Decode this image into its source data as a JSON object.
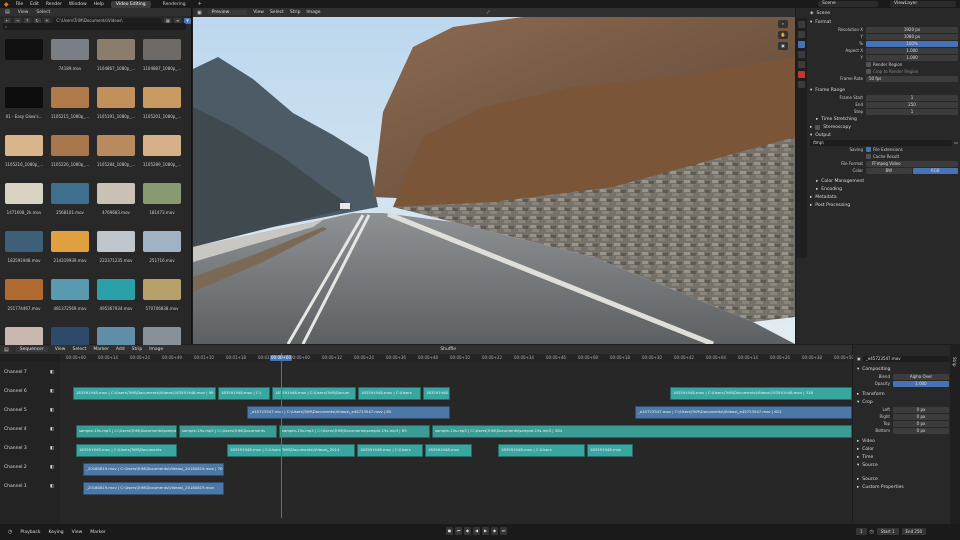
{
  "topbar": {
    "menus": [
      "File",
      "Edit",
      "Render",
      "Window",
      "Help"
    ],
    "workspaces": [
      {
        "label": "Video Editing",
        "active": true
      },
      {
        "label": "Rendering",
        "active": false
      }
    ],
    "scene": "Scene",
    "view_layer": "ViewLayer"
  },
  "file_browser": {
    "menus": [
      "View",
      "Select"
    ],
    "path": "C:\\Users\\TriM\\Documents\\Videos\\",
    "files": [
      {
        "name": "",
        "color": "#111111"
      },
      {
        "name": "74189.mov",
        "color": "#7a7f86"
      },
      {
        "name": "1104867_1080p_...",
        "color": "#8a7d6b"
      },
      {
        "name": "1104887_1080p_...",
        "color": "#6e6a66"
      },
      {
        "name": "01 - Easy Glow's...",
        "color": "#0d0d0d"
      },
      {
        "name": "1105215_1080p_...",
        "color": "#b07a4a"
      },
      {
        "name": "1105191_1080p_...",
        "color": "#c2905a"
      },
      {
        "name": "1105201_1080p_...",
        "color": "#c99b62"
      },
      {
        "name": "1105216_1080p_...",
        "color": "#d8b68a"
      },
      {
        "name": "1105226_1080p_...",
        "color": "#a8784c"
      },
      {
        "name": "1105284_1080p_...",
        "color": "#b88a5e"
      },
      {
        "name": "1105289_1080p_...",
        "color": "#d6b088"
      },
      {
        "name": "1471608_2k.mov",
        "color": "#d8d2c2"
      },
      {
        "name": "2568101.mov",
        "color": "#3f6f8f"
      },
      {
        "name": "4769683.mov",
        "color": "#c9c2b4"
      },
      {
        "name": "181473.mov",
        "color": "#8a9a70"
      },
      {
        "name": "183591948.mov",
        "color": "#3e5f78"
      },
      {
        "name": "214319939.mov",
        "color": "#e0a040"
      },
      {
        "name": "222371235.mov",
        "color": "#bfc6cc"
      },
      {
        "name": "251716.mov",
        "color": "#a0b2c4"
      },
      {
        "name": "251774467.mov",
        "color": "#b06a30"
      },
      {
        "name": "481372569.mov",
        "color": "#5a9ab0"
      },
      {
        "name": "495367934.mov",
        "color": "#2aa0a8"
      },
      {
        "name": "570706838.mov",
        "color": "#b8a06a"
      },
      {
        "name": "_23025734.mov",
        "color": "#c8b8b0"
      },
      {
        "name": "_20180819.mov",
        "color": "#2e4a6a"
      },
      {
        "name": "_19028844.mov",
        "color": "#5f8fa8"
      },
      {
        "name": "_67961324.mov",
        "color": "#88909a"
      }
    ],
    "selected_index": 25
  },
  "preview": {
    "menus": [
      "View",
      "Select",
      "Strip",
      "Image"
    ],
    "mode": "Preview"
  },
  "properties": {
    "header": "Scene",
    "format": {
      "title": "Format",
      "resolution_x": "1920 px",
      "resolution_y": "1080 px",
      "percent": "100%",
      "aspect_x": "1.000",
      "aspect_y": "1.000",
      "render_region": "Render Region",
      "crop_region": "Crop to Render Region",
      "frame_rate_label": "Frame Rate",
      "frame_rate": "50 fps"
    },
    "frame_range": {
      "title": "Frame Range",
      "start_label": "Frame Start",
      "start": "1",
      "end_label": "End",
      "end": "250",
      "step_label": "Step",
      "step": "1"
    },
    "time_stretching": "Time Stretching",
    "stereoscopy": "Stereoscopy",
    "output": {
      "title": "Output",
      "path": "/tmp\\",
      "saving_label": "Saving",
      "file_extensions": "File Extensions",
      "cache_result": "Cache Result",
      "file_format_label": "File Format",
      "file_format": "FFmpeg Video",
      "color_label": "Color",
      "color_bw": "BW",
      "color_rgb": "RGB"
    },
    "color_management": "Color Management",
    "encoding": "Encoding",
    "metadata": "Metadata",
    "post_processing": "Post Processing"
  },
  "sequencer": {
    "mode": "Sequencer",
    "menus": [
      "View",
      "Select",
      "Marker",
      "Add",
      "Strip",
      "Image"
    ],
    "shuffle": "Shuffle",
    "current_time": "00:00+00",
    "ticks": [
      "00:00+00",
      "00:00+14",
      "00:00+24",
      "00:00+49",
      "00:01+10",
      "00:01+18",
      "00:01+24",
      "00:00+00",
      "00:00+12",
      "00:00+24",
      "00:00+36",
      "00:00+48",
      "00:00+10",
      "00:00+22",
      "00:00+34",
      "00:00+46",
      "00:00+08",
      "00:00+18",
      "00:00+30",
      "00:00+42",
      "00:00+04",
      "00:00+14",
      "00:00+26",
      "00:00+38",
      "00:00+50"
    ],
    "channels": [
      "Channel 7",
      "Channel 6",
      "Channel 5",
      "Channel 4",
      "Channel 3",
      "Channel 2",
      "Channel 1"
    ],
    "strips": [
      {
        "ch": 5,
        "start": 73,
        "end": 216,
        "type": "seltxt",
        "label": "183591948.mov | C:\\Users\\TriM\\Documents\\Videos\\183591948.mov | 98"
      },
      {
        "ch": 5,
        "start": 218,
        "end": 270,
        "type": "seltxt",
        "label": "183591948.mov | C:\\"
      },
      {
        "ch": 5,
        "start": 272,
        "end": 356,
        "type": "seltxt",
        "label": "183591948.mov | C:\\Users\\TriM\\Docum"
      },
      {
        "ch": 5,
        "start": 358,
        "end": 421,
        "type": "seltxt",
        "label": "183591948.mov | C:\\Users"
      },
      {
        "ch": 5,
        "start": 423,
        "end": 450,
        "type": "seltxt",
        "label": "183591948"
      },
      {
        "ch": 5,
        "start": 670,
        "end": 852,
        "type": "seltxt",
        "label": "183591948.mov | C:\\Users\\TriM\\Documents\\Videos\\183591948.mov | 318"
      },
      {
        "ch": 4,
        "start": 247,
        "end": 450,
        "type": "movie",
        "label": "_e45723547.mov | C:\\Users\\TriM\\Documents\\Videos\\_e45723547.mov | 85"
      },
      {
        "ch": 4,
        "start": 635,
        "end": 852,
        "type": "movie",
        "label": "_e45723547.mov | C:\\Users\\TriM\\Documents\\Videos\\_e45723547.mov | 612"
      },
      {
        "ch": 3,
        "start": 76,
        "end": 177,
        "type": "sound",
        "label": "sample-15s.mp3 | C:\\Users\\TriM\\Documents\\sample-15s.mp3 | 4"
      },
      {
        "ch": 3,
        "start": 179,
        "end": 277,
        "type": "sound",
        "label": "sample-15s.mp3 | C:\\Users\\TriM\\Documents"
      },
      {
        "ch": 3,
        "start": 279,
        "end": 430,
        "type": "sound",
        "label": "sample-15s.mp3 | C:\\Users\\TriM\\Documents\\sample-15s.mp3 | 69"
      },
      {
        "ch": 3,
        "start": 432,
        "end": 852,
        "type": "sound",
        "label": "sample-15s.mp3 | C:\\Users\\TriM\\Documents\\sample-15s.mp3 | 384"
      },
      {
        "ch": 2,
        "start": 76,
        "end": 177,
        "type": "seltxt",
        "label": "183591948.mov | C:\\Users\\TriM\\Documents"
      },
      {
        "ch": 2,
        "start": 227,
        "end": 355,
        "type": "seltxt",
        "label": "183591948.mov | C:\\Users\\TriM\\Documents\\Videos\\_2014"
      },
      {
        "ch": 2,
        "start": 357,
        "end": 423,
        "type": "seltxt",
        "label": "183591948.mov | C:\\Users"
      },
      {
        "ch": 2,
        "start": 425,
        "end": 472,
        "type": "seltxt",
        "label": "183591948.mov"
      },
      {
        "ch": 2,
        "start": 498,
        "end": 585,
        "type": "seltxt",
        "label": "183591948.mov | C:\\Users"
      },
      {
        "ch": 2,
        "start": 587,
        "end": 633,
        "type": "seltxt",
        "label": "183591948.mov"
      },
      {
        "ch": 1,
        "start": 83,
        "end": 224,
        "type": "movie",
        "label": "_20180819.mov | C:\\Users\\TriM\\Documents\\Videos\\_20180819.mov | 70"
      },
      {
        "ch": 0,
        "start": 83,
        "end": 224,
        "type": "movie",
        "label": "_20180819.mov | C:\\Users\\TriM\\Documents\\Videos\\_20180819.mov"
      }
    ]
  },
  "strip_sidebar": {
    "strip_name": "_e45723547.mov",
    "compositing": "Compositing",
    "blend_label": "Blend",
    "blend": "Alpha Over",
    "opacity_label": "Opacity",
    "opacity": "1.000",
    "transform": "Transform",
    "crop": "Crop",
    "crop_left_label": "Left",
    "crop_left": "0 px",
    "crop_right_label": "Right",
    "crop_right": "0 px",
    "crop_top_label": "Top",
    "crop_top": "0 px",
    "crop_bottom_label": "Bottom",
    "crop_bottom": "0 px",
    "video": "Video",
    "color": "Color",
    "time": "Time",
    "source": "Source",
    "source2": "Source",
    "custom_properties": "Custom Properties"
  },
  "playback": {
    "menus": [
      "Playback",
      "Keying",
      "View",
      "Marker"
    ],
    "frame": "1",
    "start_label": "Start",
    "start": "1",
    "end_label": "End",
    "end": "250"
  }
}
